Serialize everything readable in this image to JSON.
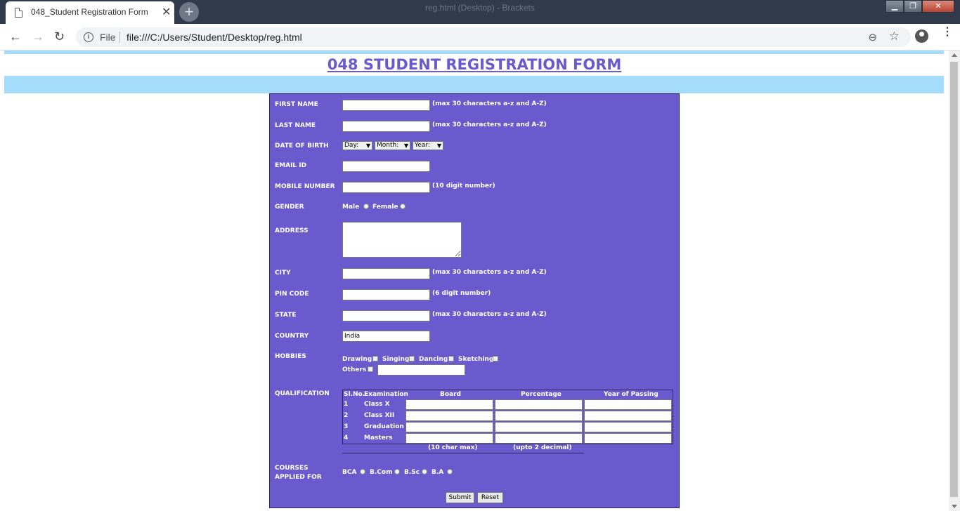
{
  "browser": {
    "window_title": "reg.html (Desktop) - Brackets",
    "tab_title": "048_Student Registration Form",
    "tab_close": "✕",
    "new_tab": "+",
    "min": "▁",
    "max": "❐",
    "close": "✕",
    "back": "←",
    "forward": "→",
    "reload": "↻",
    "info": "i",
    "file_label": "File",
    "url": "file:///C:/Users/Student/Desktop/reg.html",
    "zoom": "⊖",
    "star": "☆",
    "menu": "⋮"
  },
  "page": {
    "heading": "048  STUDENT REGISTRATION FORM"
  },
  "form": {
    "first_name": {
      "label": "FIRST NAME",
      "value": "",
      "note": "(max 30 characters a-z and A-Z)"
    },
    "last_name": {
      "label": "LAST NAME",
      "value": "",
      "note": "(max 30 characters a-z and A-Z)"
    },
    "dob": {
      "label": "DATE OF BIRTH",
      "day": "Day:",
      "month": "Month:",
      "year": "Year:"
    },
    "email": {
      "label": "EMAIL ID",
      "value": ""
    },
    "mobile": {
      "label": "MOBILE NUMBER",
      "value": "",
      "note": "(10 digit number)"
    },
    "gender": {
      "label": "GENDER",
      "male": "Male",
      "female": "Female"
    },
    "address": {
      "label": "ADDRESS",
      "value": ""
    },
    "city": {
      "label": "CITY",
      "value": "",
      "note": "(max 30 characters a-z and A-Z)"
    },
    "pin": {
      "label": "PIN CODE",
      "value": "",
      "note": "(6 digit number)"
    },
    "state": {
      "label": "STATE",
      "value": "",
      "note": "(max 30 characters a-z and A-Z)"
    },
    "country": {
      "label": "COUNTRY",
      "value": "India"
    },
    "hobbies": {
      "label": "HOBBIES",
      "items": [
        "Drawing",
        "Singing",
        "Dancing",
        "Sketching",
        "Others"
      ]
    },
    "qualification": {
      "label": "QUALIFICATION",
      "headers": [
        "Sl.No.",
        "Examination",
        "Board",
        "Percentage",
        "Year of Passing"
      ],
      "rows": [
        {
          "sl": "1",
          "exam": "Class X"
        },
        {
          "sl": "2",
          "exam": "Class XII"
        },
        {
          "sl": "3",
          "exam": "Graduation"
        },
        {
          "sl": "4",
          "exam": "Masters"
        }
      ],
      "board_note": "(10 char max)",
      "percent_note": "(upto 2 decimal)"
    },
    "courses": {
      "label_line1": "COURSES",
      "label_line2": "APPLIED FOR",
      "items": [
        "BCA",
        "B.Com",
        "B.Sc",
        "B.A"
      ]
    },
    "submit": "Submit",
    "reset": "Reset"
  }
}
